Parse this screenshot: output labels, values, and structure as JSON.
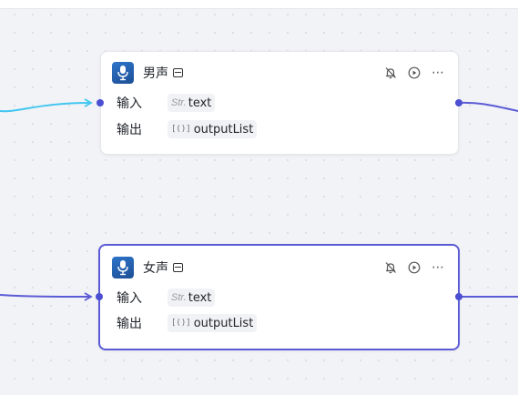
{
  "nodes": [
    {
      "title": "男声",
      "selected": false,
      "input": {
        "label": "输入",
        "type": "Str.",
        "value": "text"
      },
      "output": {
        "label": "输出",
        "type": "[()]",
        "value": "outputList"
      }
    },
    {
      "title": "女声",
      "selected": true,
      "input": {
        "label": "输入",
        "type": "Str.",
        "value": "text"
      },
      "output": {
        "label": "输出",
        "type": "[()]",
        "value": "outputList"
      }
    }
  ],
  "icons": {
    "node": "microphone-icon",
    "title_badge": "panel-icon",
    "disable": "bell-off-icon",
    "run": "play-circle-icon",
    "more": "more-horizontal-icon"
  },
  "colors": {
    "canvas": "#f2f3f7",
    "edge_active": "#41c6f0",
    "edge": "#5b5bd6",
    "port": "#4b4fd1",
    "selected_border": "#5b5bd6"
  }
}
